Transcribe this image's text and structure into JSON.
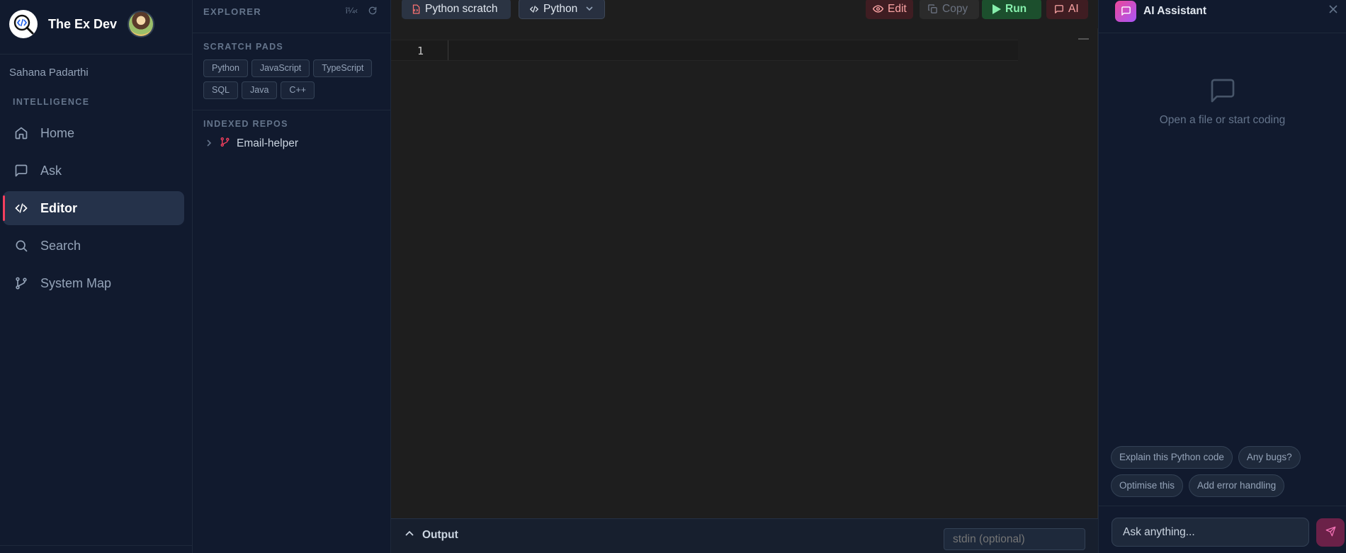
{
  "colors": {
    "background": "#0f172a",
    "panel": "#111a2e",
    "editor_bg": "#1e1e1e",
    "accent": "#f43f5e",
    "run_green": "#86efac"
  },
  "nav": {
    "brand_name": "The Ex Dev",
    "brand_icon": "code-search-logo",
    "user_name": "Sahana Padarthi",
    "section_label": "INTELLIGENCE",
    "items": [
      {
        "label": "Home",
        "icon": "home-icon"
      },
      {
        "label": "Ask",
        "icon": "chat-icon"
      },
      {
        "label": "Editor",
        "icon": "code-icon",
        "active": true
      },
      {
        "label": "Search",
        "icon": "search-icon"
      },
      {
        "label": "System Map",
        "icon": "git-branch-icon"
      }
    ]
  },
  "explorer": {
    "title": "EXPLORER",
    "tool_glyph": "î¼‹",
    "scratch_label": "SCRATCH PADS",
    "pads": [
      "Python",
      "JavaScript",
      "TypeScript",
      "SQL",
      "Java",
      "C++"
    ],
    "repos_label": "INDEXED REPOS",
    "repos": [
      {
        "name": "Email-helper"
      }
    ]
  },
  "editor": {
    "tab_label": "Python scratch",
    "language": "Python",
    "buttons": {
      "edit": "Edit",
      "copy": "Copy",
      "run": "Run",
      "ai": "AI"
    },
    "line_number": "1",
    "output_label": "Output",
    "stdin_placeholder": "stdin (optional)"
  },
  "ai": {
    "title": "AI Assistant",
    "empty_text": "Open a file or start coding",
    "suggestions": [
      "Explain this Python code",
      "Any bugs?",
      "Optimise this",
      "Add error handling"
    ],
    "input_placeholder": "Ask anything..."
  }
}
